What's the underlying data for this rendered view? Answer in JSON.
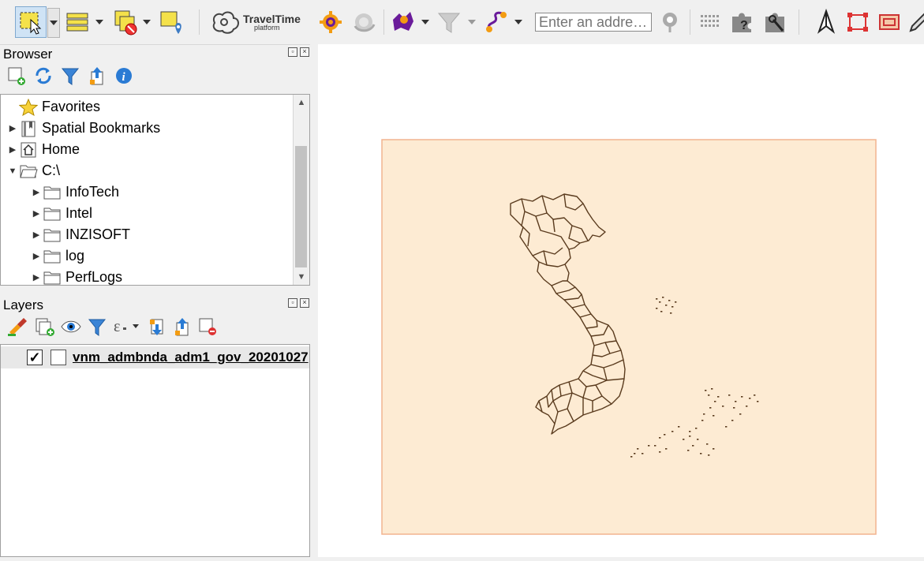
{
  "toolbar": {
    "icons": [
      "select-features-icon",
      "select-dropdown",
      "attribute-table-icon",
      "select-by-location-icon",
      "identify-icon",
      "traveltime-logo",
      "settings-icon",
      "settings-disabled-icon",
      "isochrone-icon",
      "filter-icon",
      "route-icon",
      "geocoder-search-icon",
      "grid-icon",
      "help-icon",
      "tools-icon",
      "north-arrow-icon",
      "rectangle-select-icon",
      "map-frame-icon",
      "edit-pencil-icon"
    ],
    "traveltime_brand": "TravelTime",
    "traveltime_sub": "platform",
    "address_placeholder": "Enter an addre…"
  },
  "browser": {
    "title": "Browser",
    "items": [
      {
        "label": "Favorites",
        "icon": "star-icon",
        "expand": "none"
      },
      {
        "label": "Spatial Bookmarks",
        "icon": "bookmark-icon",
        "expand": "collapsed"
      },
      {
        "label": "Home",
        "icon": "home-icon",
        "expand": "collapsed"
      },
      {
        "label": "C:\\",
        "icon": "folder-open-icon",
        "expand": "expanded"
      },
      {
        "label": "InfoTech",
        "icon": "folder-icon",
        "expand": "collapsed"
      },
      {
        "label": "Intel",
        "icon": "folder-icon",
        "expand": "collapsed"
      },
      {
        "label": "INZISOFT",
        "icon": "folder-icon",
        "expand": "collapsed"
      },
      {
        "label": "log",
        "icon": "folder-icon",
        "expand": "collapsed"
      },
      {
        "label": "PerfLogs",
        "icon": "folder-icon",
        "expand": "collapsed"
      }
    ]
  },
  "layers": {
    "title": "Layers",
    "items": [
      {
        "name": "vnm_admbnda_adm1_gov_20201027",
        "checked": true
      }
    ]
  },
  "map": {
    "background": "#fdebd3",
    "border_color": "#f2b48f",
    "boundary_color": "#5a3b1e"
  }
}
